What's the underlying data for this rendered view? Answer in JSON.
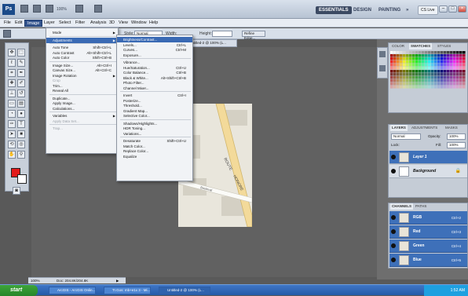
{
  "app": {
    "logo": "Ps",
    "zoom": "100%"
  },
  "workspace_switcher": [
    "ESSENTIALS",
    "DESIGN",
    "PAINTING",
    "»"
  ],
  "cs_live": "CS Live",
  "menubar": [
    "File",
    "Edit",
    "Image",
    "Layer",
    "Select",
    "Filter",
    "Analysis",
    "3D",
    "View",
    "Window",
    "Help"
  ],
  "options_bar": {
    "style_label": "Style:",
    "style_value": "Normal",
    "width_label": "Width:",
    "height_label": "Height:",
    "refine_edge": "Refine Edge..."
  },
  "image_menu": [
    {
      "label": "Mode",
      "submenu": true
    },
    {
      "sep": true
    },
    {
      "label": "Adjustments",
      "submenu": true,
      "selected": true
    },
    {
      "sep": true
    },
    {
      "label": "Auto Tone",
      "shortcut": "Shift+Ctrl+L"
    },
    {
      "label": "Auto Contrast",
      "shortcut": "Alt+Shift+Ctrl+L"
    },
    {
      "label": "Auto Color",
      "shortcut": "Shift+Ctrl+B"
    },
    {
      "sep": true
    },
    {
      "label": "Image Size...",
      "shortcut": "Alt+Ctrl+I"
    },
    {
      "label": "Canvas Size...",
      "shortcut": "Alt+Ctrl+C"
    },
    {
      "label": "Image Rotation",
      "submenu": true
    },
    {
      "label": "Crop",
      "disabled": true
    },
    {
      "label": "Trim..."
    },
    {
      "label": "Reveal All"
    },
    {
      "sep": true
    },
    {
      "label": "Duplicate..."
    },
    {
      "label": "Apply Image..."
    },
    {
      "label": "Calculations..."
    },
    {
      "sep": true
    },
    {
      "label": "Variables",
      "submenu": true
    },
    {
      "label": "Apply Data Set...",
      "disabled": true
    },
    {
      "sep": true
    },
    {
      "label": "Trap...",
      "disabled": true
    }
  ],
  "adjustments_menu": [
    {
      "label": "Brightness/Contrast...",
      "selected": true
    },
    {
      "label": "Levels...",
      "shortcut": "Ctrl+L"
    },
    {
      "label": "Curves...",
      "shortcut": "Ctrl+M"
    },
    {
      "label": "Exposure..."
    },
    {
      "sep": true
    },
    {
      "label": "Vibrance..."
    },
    {
      "label": "Hue/Saturation...",
      "shortcut": "Ctrl+U"
    },
    {
      "label": "Color Balance...",
      "shortcut": "Ctrl+B"
    },
    {
      "label": "Black & White...",
      "shortcut": "Alt+Shift+Ctrl+B"
    },
    {
      "label": "Photo Filter..."
    },
    {
      "label": "Channel Mixer..."
    },
    {
      "sep": true
    },
    {
      "label": "Invert",
      "shortcut": "Ctrl+I"
    },
    {
      "label": "Posterize..."
    },
    {
      "label": "Threshold..."
    },
    {
      "label": "Gradient Map..."
    },
    {
      "label": "Selective Color..."
    },
    {
      "sep": true
    },
    {
      "label": "Shadows/Highlights..."
    },
    {
      "label": "HDR Toning..."
    },
    {
      "label": "Variations..."
    },
    {
      "sep": true
    },
    {
      "label": "Desaturate",
      "shortcut": "Shift+Ctrl+U"
    },
    {
      "label": "Match Color..."
    },
    {
      "label": "Replace Color..."
    },
    {
      "label": "Equalize"
    }
  ],
  "swatches_tabs": [
    "COLOR",
    "SWATCHES",
    "STYLES"
  ],
  "layers_tabs": [
    "LAYERS",
    "ADJUSTMENTS",
    "MASKS"
  ],
  "layers": {
    "blend_mode": "Normal",
    "opacity_label": "Opacity:",
    "opacity": "100%",
    "lock_label": "Lock:",
    "fill_label": "Fill:",
    "fill": "100%",
    "items": [
      {
        "name": "Layer 1",
        "selected": true
      },
      {
        "name": "Background",
        "selected": false
      }
    ]
  },
  "channels_tabs": [
    "CHANNELS",
    "PATHS"
  ],
  "channels": [
    {
      "name": "RGB",
      "shortcut": "Ctrl+2"
    },
    {
      "name": "Red",
      "shortcut": "Ctrl+3"
    },
    {
      "name": "Green",
      "shortcut": "Ctrl+4"
    },
    {
      "name": "Blue",
      "shortcut": "Ctrl+5"
    }
  ],
  "status": {
    "zoom": "100%",
    "doc": "Doc: 204.8K/204.8K"
  },
  "document_tab": "Untitled-2 @ 100% (L...",
  "map_labels": [
    "ROUTE",
    "HONORE",
    "Bouleval"
  ],
  "taskbar": {
    "start": "start",
    "tasks": [
      "ArcGIS - ArcGIS Onlin...",
      "Tr.Gos: mb+e1x 3 - Mi...",
      "Untitled-2 @ 100% (L..."
    ],
    "clock": "1:52 AM"
  },
  "colors": {
    "accent": "#3a6ab4",
    "foreground": "#e21b1b",
    "background": "#ffffff"
  }
}
